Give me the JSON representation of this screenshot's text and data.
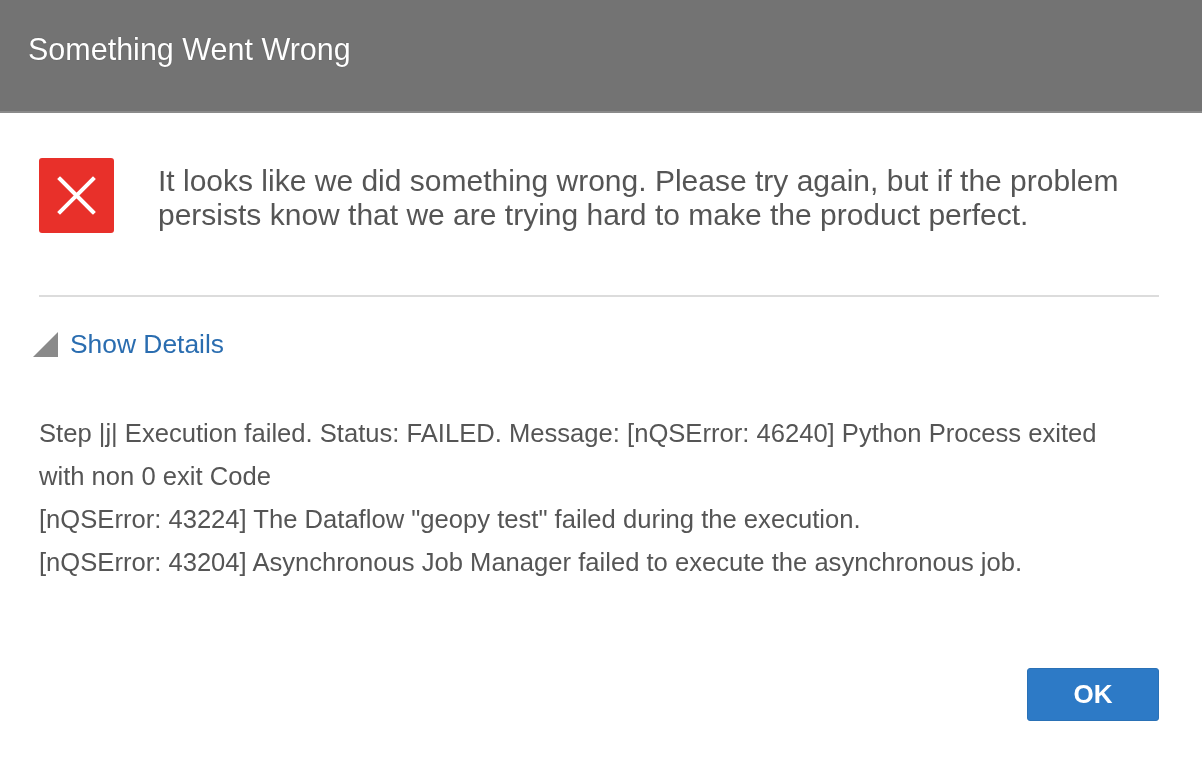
{
  "dialog": {
    "title": "Something Went Wrong",
    "message": "It looks like we did something wrong. Please try again, but if the problem persists know that we are trying hard to make the product perfect."
  },
  "details": {
    "toggle_label": "Show Details",
    "expanded": true,
    "lines": [
      "Step |j| Execution failed. Status: FAILED. Message: [nQSError: 46240] Python Process exited with non 0 exit Code",
      "[nQSError: 43224] The Dataflow \"geopy test\" failed during the execution.",
      "[nQSError: 43204] Asynchronous Job Manager failed to execute the asynchronous job."
    ]
  },
  "buttons": [
    {
      "label": "OK",
      "kind": "primary"
    }
  ]
}
